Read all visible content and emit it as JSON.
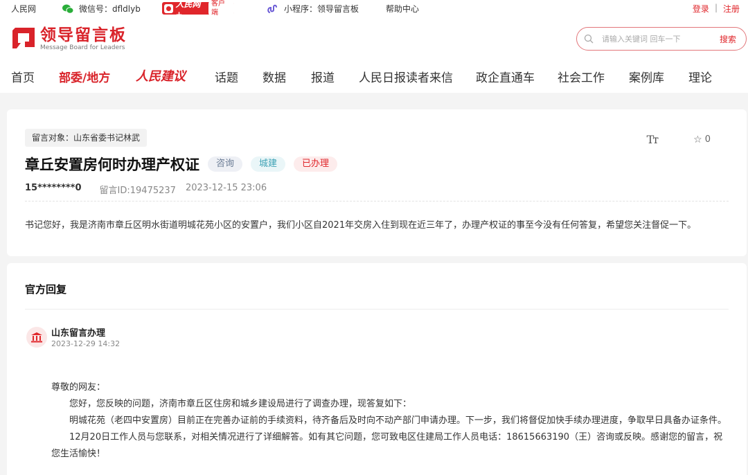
{
  "topbar": {
    "site": "人民网",
    "wechat": "微信号：dfldlyb",
    "app_brand": "人民网+",
    "app_tag": "客户端",
    "mini": "小程序：领导留言板",
    "help": "帮助中心",
    "login": "登录",
    "sep": "|",
    "register": "注册"
  },
  "logo": {
    "cn": "领导留言板",
    "en": "Message Board for Leaders"
  },
  "search": {
    "placeholder": "请输入关键词 回车一下",
    "button": "搜索"
  },
  "nav": [
    "首页",
    "部委/地方",
    "人民建议",
    "话题",
    "数据",
    "报道",
    "人民日报读者来信",
    "政企直通车",
    "社会工作",
    "案例库",
    "理论"
  ],
  "message": {
    "target": "留言对象：山东省委书记林武",
    "font_label": "Tт",
    "star_count": "0",
    "title": "章丘安置房何时办理产权证",
    "tags": [
      "咨询",
      "城建",
      "已办理"
    ],
    "user": "15********0",
    "id": "留言ID:19475237",
    "time": "2023-12-15 23:06",
    "content": "书记您好，我是济南市章丘区明水街道明城花苑小区的安置户，我们小区自2021年交房入住到现在近三年了，办理产权证的事至今没有任何答复，希望您关注督促一下。"
  },
  "reply": {
    "heading": "官方回复",
    "org": "山东留言办理",
    "time": "2023-12-29 14:32",
    "salutation": "尊敬的网友：",
    "p1": "您好，您反映的问题，济南市章丘区住房和城乡建设局进行了调查办理，现答复如下：",
    "p2": "明城花苑（老四中安置房）目前正在完善办证前的手续资料，待齐备后及时向不动产部门申请办理。下一步，我们将督促加快手续办理进度，争取早日具备办证条件。",
    "p3": "12月20日工作人员与您联系，对相关情况进行了详细解答。如有其它问题，您可致电区住建局工作人员电话：18615663190（王）咨询或反映。感谢您的留言，祝您生活愉快！"
  }
}
